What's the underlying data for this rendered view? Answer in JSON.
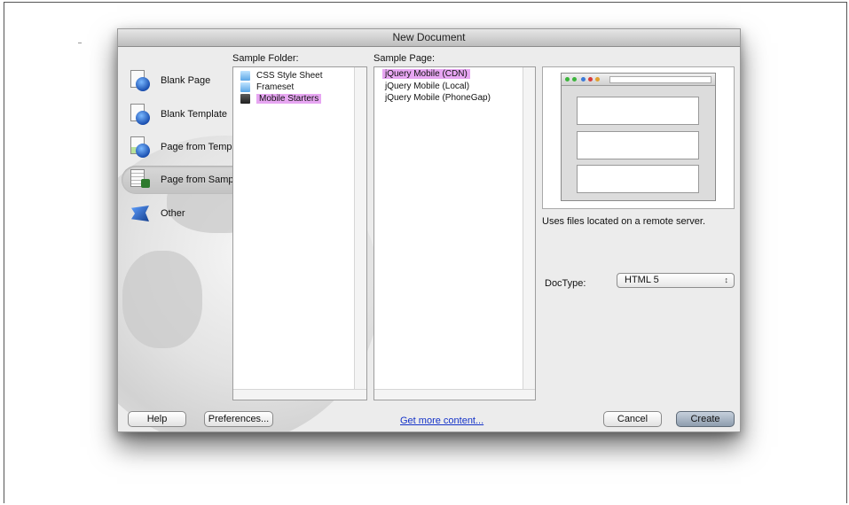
{
  "dialog": {
    "title": "New Document",
    "categories": [
      {
        "label": "Blank Page",
        "icon": "blank-page-icon"
      },
      {
        "label": "Blank Template",
        "icon": "blank-template-icon"
      },
      {
        "label": "Page from Template",
        "icon": "page-from-template-icon"
      },
      {
        "label": "Page from Sample",
        "icon": "page-from-sample-icon",
        "selected": true
      },
      {
        "label": "Other",
        "icon": "other-icon"
      }
    ],
    "sample_folder": {
      "label": "Sample Folder:",
      "items": [
        {
          "label": "CSS Style Sheet",
          "icon": "folder-icon"
        },
        {
          "label": "Frameset",
          "icon": "folder-icon"
        },
        {
          "label": "Mobile Starters",
          "icon": "folder-dark-icon",
          "selected": true
        }
      ]
    },
    "sample_page": {
      "label": "Sample Page:",
      "items": [
        {
          "label": "jQuery Mobile (CDN)",
          "selected": true
        },
        {
          "label": "jQuery Mobile (Local)"
        },
        {
          "label": "jQuery Mobile (PhoneGap)"
        }
      ]
    },
    "description": "Uses files located on a remote server.",
    "doctype": {
      "label": "DocType:",
      "value": "HTML 5",
      "arrows": "↕"
    },
    "buttons": {
      "help": "Help",
      "preferences": "Preferences...",
      "get_more": "Get more content...",
      "cancel": "Cancel",
      "create": "Create"
    },
    "colors": {
      "selection": "#e7a6f2",
      "link": "#1432c8",
      "primary_button": "#8e9dae"
    }
  }
}
